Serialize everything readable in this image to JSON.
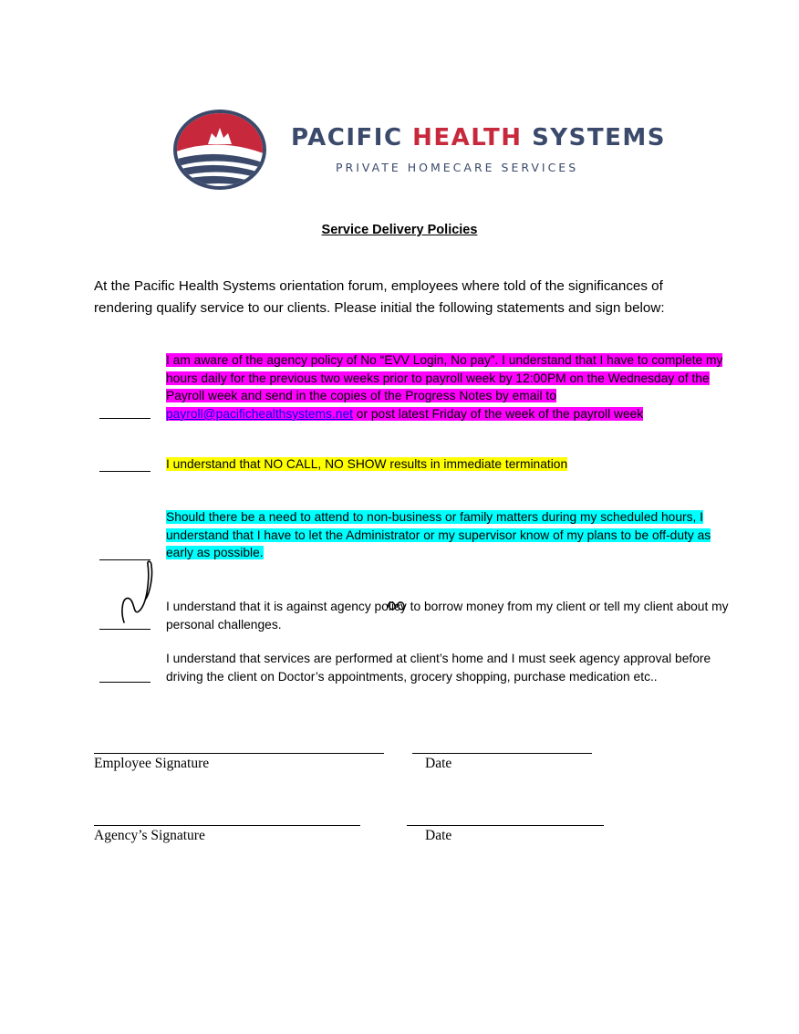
{
  "logo": {
    "name_part1": "PACIFIC ",
    "name_part2": "HEALTH",
    "name_part3": " SYSTEMS",
    "tagline": "PRIVATE HOMECARE SERVICES",
    "colors": {
      "navy": "#3b4a6b",
      "red": "#c8283c"
    }
  },
  "title": "Service Delivery Policies",
  "intro": "At the Pacific Health Systems orientation forum, employees where told of the significances of rendering qualify service to our clients. Please initial the following statements and sign below:",
  "statements": [
    {
      "text_before": "I am aware of the agency policy of No “EVV Login, No pay”.  I understand that I have to complete my hours daily for the previous two weeks prior to payroll week by 12:00PM on the Wednesday of the Payroll week and send in the copies of the Progress Notes by email to ",
      "email": "payroll@pacifichealthsystems.net",
      "text_after": " or post latest Friday of the week of the payroll week",
      "highlight": "#ff00ff"
    },
    {
      "text": "I understand that NO CALL, NO SHOW results in immediate termination",
      "highlight": "#ffff00"
    },
    {
      "text": "Should there be a need to attend to non-business or family matters during my scheduled hours, I understand that I have to let the Administrator or my supervisor know of my plans to be off-duty as early as possible.",
      "highlight": "#00ffff"
    },
    {
      "text": "I understand that it is against agency policy to borrow money from my client or tell my client about my personal challenges."
    },
    {
      "text": "I understand that services are performed at client’s home and I must seek agency approval before driving the client on Doctor’s appointments, grocery shopping, purchase medication etc.."
    }
  ],
  "signatures": {
    "employee_label": "Employee Signature",
    "employee_date_label": "Date",
    "agency_label": "Agency’s Signature",
    "agency_date_label": "Date"
  }
}
